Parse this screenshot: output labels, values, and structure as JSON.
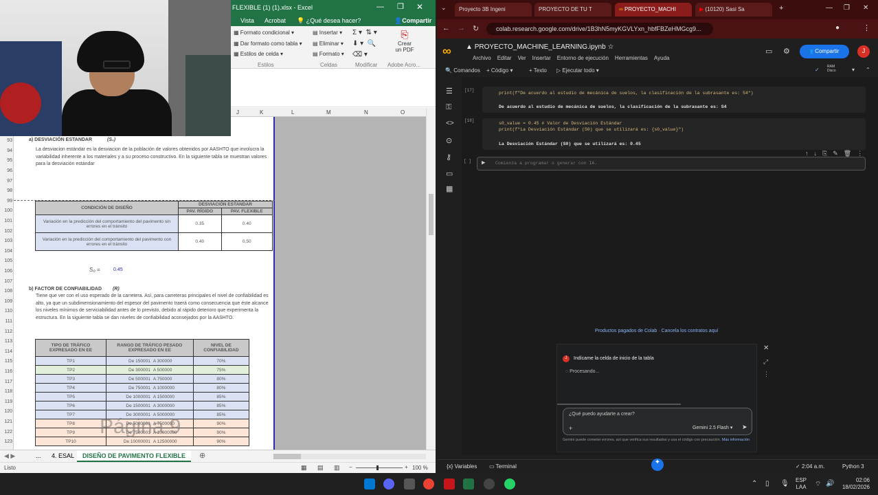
{
  "excel": {
    "title": "FLEXIBLE (1) (1).xlsx - Excel",
    "ribbon_tabs": [
      "Vista",
      "Acrobat"
    ],
    "tell_me": "¿Qué desea hacer?",
    "share": "Compartir",
    "ribbon_items": [
      "Formato condicional",
      "Dar formato como tabla",
      "Estilos de celda",
      "Insertar",
      "Eliminar",
      "Formato",
      "Crear un PDF"
    ],
    "groups": [
      "Estilos",
      "Celdas",
      "Modificar",
      "Adobe Acro..."
    ],
    "columns": [
      "J",
      "K",
      "L",
      "M",
      "N",
      "O"
    ],
    "rows": [
      "93",
      "92",
      "93",
      "94",
      "95",
      "96",
      "97",
      "98",
      "99",
      "100",
      "101",
      "102",
      "103",
      "104",
      "105",
      "106",
      "107",
      "108",
      "109",
      "110",
      "111",
      "112",
      "113",
      "114",
      "115",
      "116",
      "117",
      "118",
      "119",
      "120",
      "121",
      "122",
      "123"
    ],
    "section_a": "a) DESVIACIÓN ESTANDAR",
    "so_symbol": "(S₀)",
    "para_a": "La desviacion estándar es la desviacion de la población de valores obtenidos por AASHTO que involucra la variabilidad inherente a los materiales y a su proceso constructivo. En la siguiente tabla se muestran valores para la desviación estándar",
    "table1": {
      "h1": "CONDICIÓN DE DISEÑO",
      "h2": "DESVIACIÓN ESTANDAR",
      "h3": "PAV. RÍGIDO",
      "h4": "PAV. FLEXIBLE",
      "r1": "Variación en la predicción del comportamiento del pavimento sin errores en el tránsito",
      "r1a": "0.35",
      "r1b": "0.40",
      "r2": "Variación en la predicción del comportamiento del pavimento con errores en el tránsito",
      "r2a": "0.40",
      "r2b": "0.50"
    },
    "so_label": "S₀ =",
    "so_value": "0.45",
    "section_b": "b) FACTOR DE CONFIABILIDAD",
    "r_symbol": "(R)",
    "para_b": "Tiene que ver con el uso esperado de la carretera. Así, para carreteras principales el nivel de confiabilidad es alto, ya que un subdimensionamiento del espesor del pavimento traerá como consecuencia que éste alcance los niveles mínimos de serviciabilidad antes de lo previsto, debido al rápido deterioro que experimenta la estructura. En la siguiente tabla se dan niveles de confiabilidad aconsejados por la AASHTO.",
    "table2": {
      "h1": "TIPO DE TRÁFICO EXPRESADO EN EE",
      "h2": "RANGO DE TRÁFICO PESADO EXPRESADO EN EE",
      "h3": "NIVEL DE CONFIABILIDAD",
      "rows": [
        {
          "t": "TP1",
          "a": "De 150001",
          "b": "A 300000",
          "c": "70%"
        },
        {
          "t": "TP2",
          "a": "De 300001",
          "b": "A 500000",
          "c": "75%"
        },
        {
          "t": "TP3",
          "a": "De 500001",
          "b": "A 750000",
          "c": "80%"
        },
        {
          "t": "TP4",
          "a": "De 750001",
          "b": "A 1000000",
          "c": "80%"
        },
        {
          "t": "TP5",
          "a": "De 1000001",
          "b": "A 1500000",
          "c": "85%"
        },
        {
          "t": "TP6",
          "a": "De 1500001",
          "b": "A 3000000",
          "c": "85%"
        },
        {
          "t": "TP7",
          "a": "De 3000001",
          "b": "A 5000000",
          "c": "85%"
        },
        {
          "t": "TP8",
          "a": "De 5000001",
          "b": "A 7500000",
          "c": "90%"
        },
        {
          "t": "TP9",
          "a": "De 7500001",
          "b": "A 10000000",
          "c": "90%"
        },
        {
          "t": "TP10",
          "a": "De 10000001",
          "b": "A 12500000",
          "c": "90%"
        }
      ]
    },
    "watermark": "Página 9",
    "sheet_tabs": [
      "...",
      "4. ESAL",
      "DISEÑO DE PAVIMENTO FLEXIBLE"
    ],
    "status_left": "Listo",
    "zoom": "100 %"
  },
  "chrome": {
    "tabs": [
      "Proyecto 3B Ingeni",
      "PROYECTO DE TU T",
      "PROYECTO_MACHI",
      "(10120) Sasi Sa"
    ],
    "url": "colab.research.google.com/drive/1B3hN5myKGVLYxn_hbfFBZeHMGcg9...",
    "colab": {
      "filename": "PROYECTO_MACHINE_LEARNING.ipynb",
      "menu": [
        "Archivo",
        "Editar",
        "Ver",
        "Insertar",
        "Entorno de ejecución",
        "Herramientas",
        "Ayuda"
      ],
      "share": "Compartir",
      "avatar": "J",
      "toolbar": [
        "Comandos",
        "+ Código",
        "+ Texto",
        "Ejecutar todo"
      ],
      "ram": "RAM",
      "disk": "Disco",
      "cells": [
        {
          "n": "[17]",
          "code": [
            "print(f\"De acuerdo al estudio de mecánica de suelos, la clasificación de la subrasante es: S4\")"
          ],
          "out": "De acuerdo al estudio de mecánica de suelos, la clasificación de la subrasante es: S4"
        },
        {
          "n": "[18]",
          "code": [
            "s0_value = 0.45 # Valor de Desviación Estándar",
            "print(f\"La Desviación Estándar (S0) que se utilizará es: {s0_value}\")"
          ],
          "out": "La Desviación Estándar (S0) que se utilizará es: 0.45"
        }
      ],
      "empty_cell_num": "[ ]",
      "placeholder": "Comienza a programar o generar con IA.",
      "paid_products": "Productos pagados de Colab",
      "cancel_contracts": "Cancela los contratos aquí",
      "gemini": {
        "prompt": "Indícame la celda de inicio de la tabla",
        "processing": "Procesando...",
        "input_placeholder": "¿Qué puedo ayudarte a crear?",
        "model": "Gemini 2.5 Flash",
        "disclaimer": "Gemini puede cometer errores, así que verifica sus resultados y usa el código con precaución.",
        "more": "Más información"
      },
      "status": {
        "variables": "Variables",
        "terminal": "Terminal",
        "time": "2:04 a.m.",
        "runtime": "Python 3"
      }
    }
  },
  "taskbar": {
    "lang1": "ESP",
    "lang2": "LAA",
    "time": "02:06",
    "date": "18/02/2026"
  }
}
